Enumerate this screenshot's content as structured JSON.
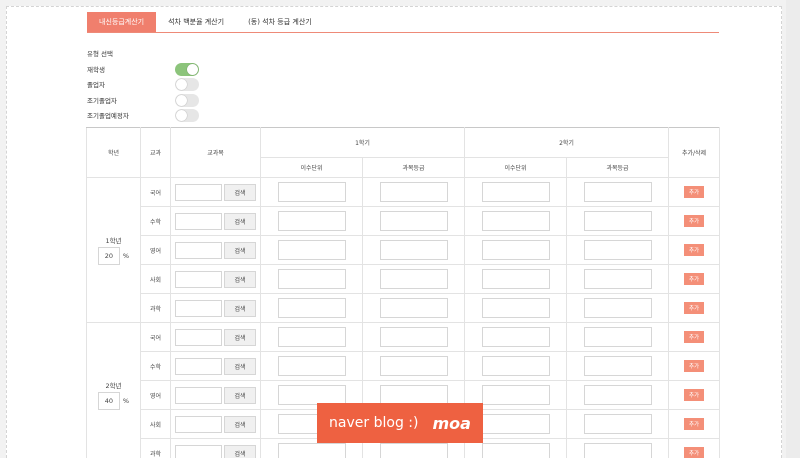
{
  "tabs": [
    {
      "label": "내신등급계산기",
      "active": true
    },
    {
      "label": "석차 백분율 계산기",
      "active": false
    },
    {
      "label": "(동) 석차 등급 계산기",
      "active": false
    }
  ],
  "type_select": {
    "title": "유형 선택",
    "options": [
      {
        "label": "재학생",
        "on": true
      },
      {
        "label": "졸업자",
        "on": false
      },
      {
        "label": "조기졸업자",
        "on": false
      },
      {
        "label": "조기졸업예정자",
        "on": false
      }
    ]
  },
  "table": {
    "headers": {
      "year": "학년",
      "subject_group": "교과",
      "subject": "교과목",
      "sem1": "1학기",
      "sem2": "2학기",
      "credits": "이수단위",
      "grade": "과목등급",
      "add_delete": "추가/삭제"
    },
    "search_label": "검색",
    "add_label": "추가",
    "percent_sign": "%",
    "years": [
      {
        "label": "1학년",
        "weight": "20",
        "subjects": [
          "국어",
          "수학",
          "영어",
          "사회",
          "과학"
        ]
      },
      {
        "label": "2학년",
        "weight": "40",
        "subjects": [
          "국어",
          "수학",
          "영어",
          "사회",
          "과학"
        ]
      }
    ]
  },
  "watermark": {
    "text": "naver blog :)",
    "brand": "moa"
  },
  "colors": {
    "accent": "#f07f6d",
    "toggle_on": "#8cc47b",
    "add_button": "#f48f78",
    "watermark": "#ee6141"
  }
}
